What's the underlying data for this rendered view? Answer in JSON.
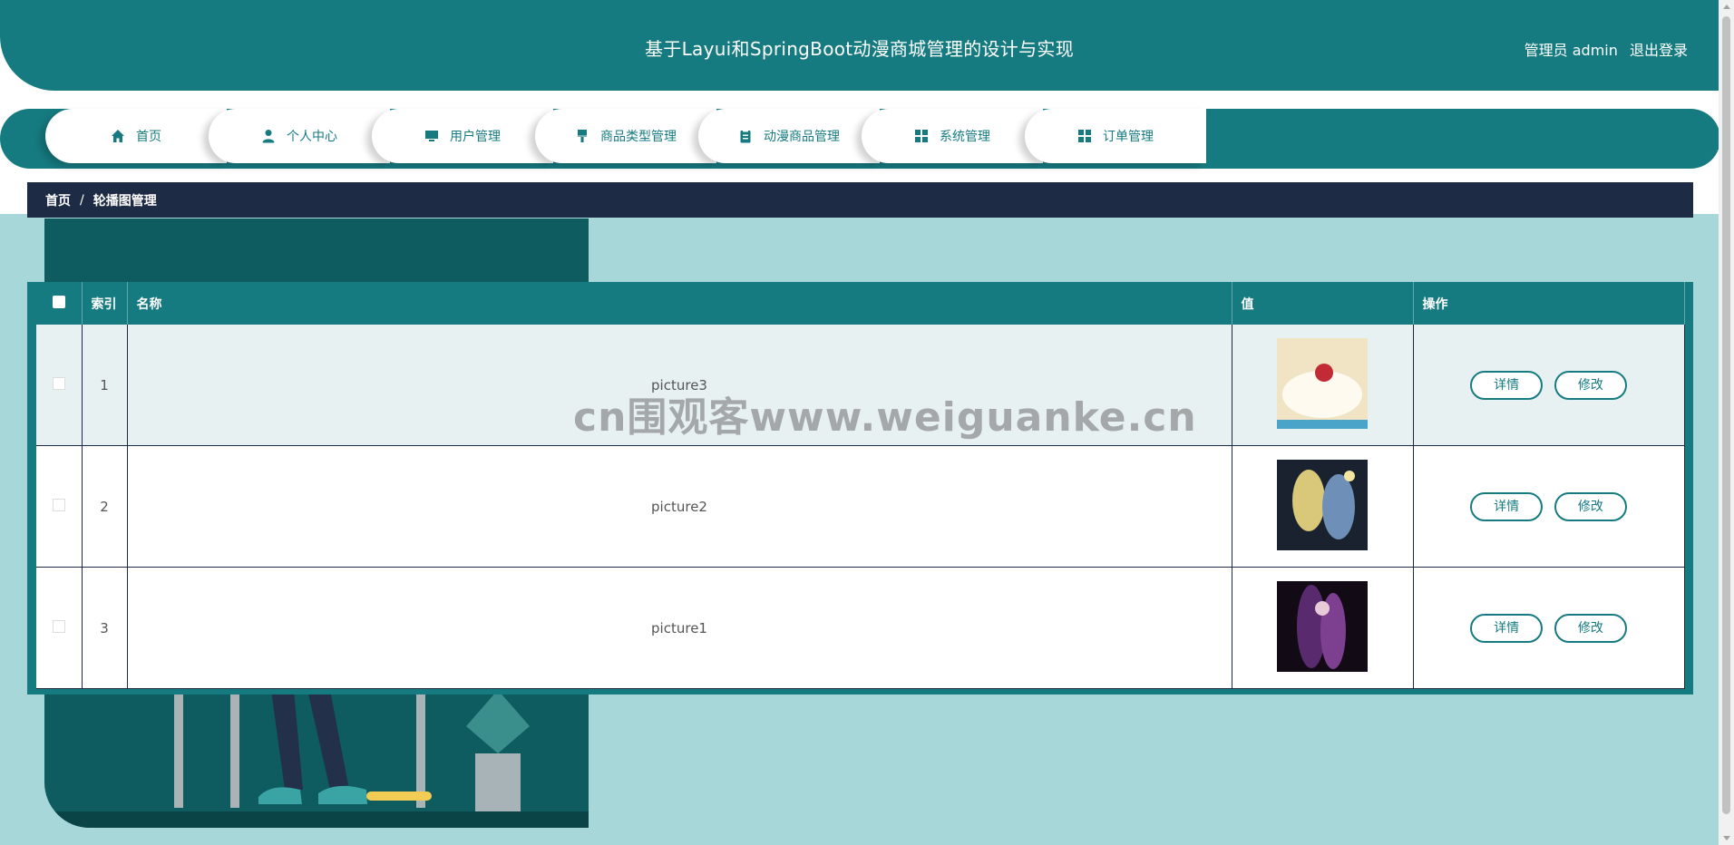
{
  "header": {
    "title": "基于Layui和SpringBoot动漫商城管理的设计与实现",
    "user": "管理员 admin",
    "logout": "退出登录"
  },
  "nav": [
    {
      "label": "首页",
      "icon": "home-icon"
    },
    {
      "label": "个人中心",
      "icon": "user-icon"
    },
    {
      "label": "用户管理",
      "icon": "monitor-icon"
    },
    {
      "label": "商品类型管理",
      "icon": "brush-icon"
    },
    {
      "label": "动漫商品管理",
      "icon": "clipboard-icon"
    },
    {
      "label": "系统管理",
      "icon": "grid-icon"
    },
    {
      "label": "订单管理",
      "icon": "grid-icon"
    }
  ],
  "breadcrumb": {
    "home": "首页",
    "sep": "/",
    "current": "轮播图管理"
  },
  "table": {
    "headers": {
      "index": "索引",
      "name": "名称",
      "value": "值",
      "actions": "操作"
    },
    "rows": [
      {
        "index": "1",
        "name": "picture3",
        "detail": "详情",
        "edit": "修改"
      },
      {
        "index": "2",
        "name": "picture2",
        "detail": "详情",
        "edit": "修改"
      },
      {
        "index": "3",
        "name": "picture1",
        "detail": "详情",
        "edit": "修改"
      }
    ]
  },
  "watermark": "cn围观客www.weiguanke.cn",
  "colors": {
    "primary": "#167b80",
    "dark": "#1e2b44",
    "bg": "#a7d7d8"
  }
}
